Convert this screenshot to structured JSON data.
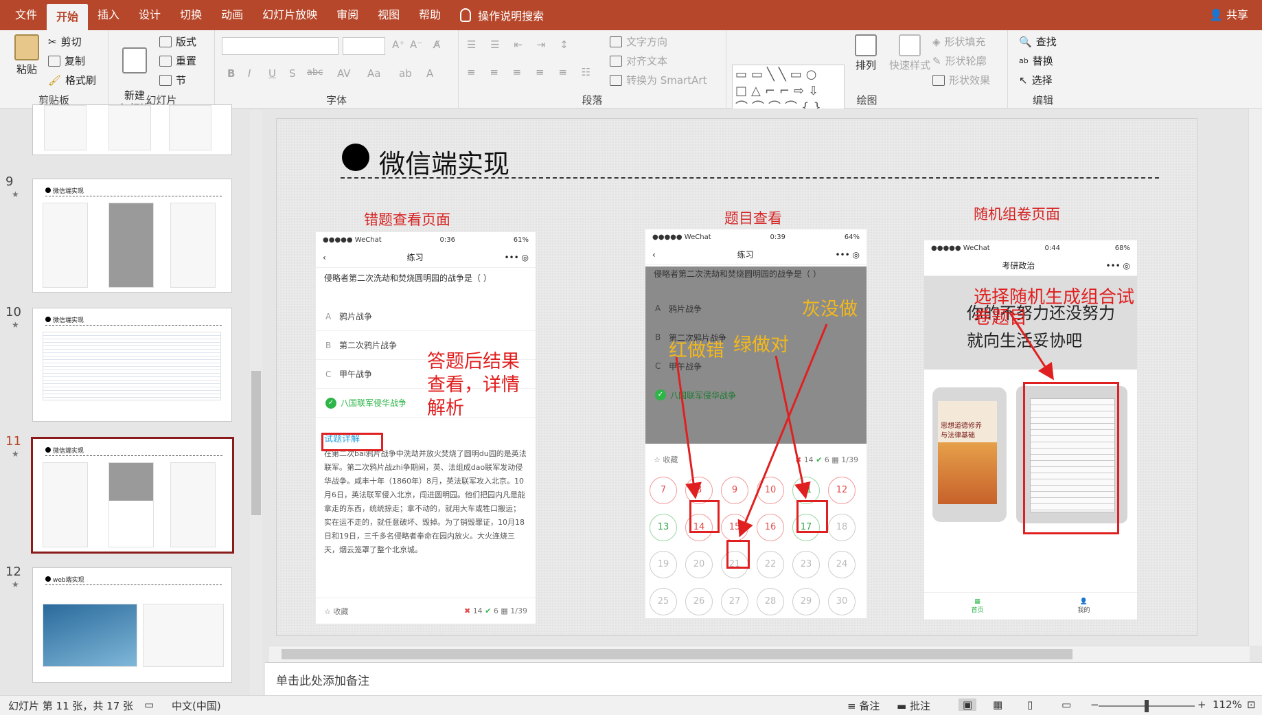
{
  "tabs": [
    "文件",
    "开始",
    "插入",
    "设计",
    "切换",
    "动画",
    "幻灯片放映",
    "审阅",
    "视图",
    "帮助"
  ],
  "tellme": "操作说明搜索",
  "share": "共享",
  "ribbon": {
    "clipboard": {
      "paste": "粘贴",
      "cut": "剪切",
      "copy": "复制",
      "format_painter": "格式刷",
      "label": "剪贴板"
    },
    "slides": {
      "new_slide": "新建\n幻灯片",
      "layout": "版式",
      "reset": "重置",
      "section": "节",
      "label": "幻灯片"
    },
    "font": {
      "label": "字体",
      "bold": "B",
      "italic": "I",
      "underline": "U",
      "shadow": "S",
      "strike": "abc",
      "spacing": "AV",
      "case": "Aa",
      "color": "A"
    },
    "paragraph": {
      "label": "段落",
      "text_direction": "文字方向",
      "align_text": "对齐文本",
      "smartart": "转换为 SmartArt"
    },
    "drawing": {
      "label": "绘图",
      "arrange": "排列",
      "quick_styles": "快速样式",
      "fill": "形状填充",
      "outline": "形状轮廓",
      "effects": "形状效果"
    },
    "editing": {
      "label": "编辑",
      "find": "查找",
      "replace": "替换",
      "select": "选择"
    }
  },
  "thumbnails": [
    {
      "num": "",
      "title": ""
    },
    {
      "num": "9",
      "title": "微信端实现"
    },
    {
      "num": "10",
      "title": "微信端实现"
    },
    {
      "num": "11",
      "title": "微信端实现"
    },
    {
      "num": "12",
      "title": "web端实现"
    }
  ],
  "slide": {
    "title": "微信端实现",
    "captions": [
      "错题查看页面",
      "题目查看",
      "随机组卷页面"
    ],
    "phone1": {
      "carrier": "●●●●● WeChat",
      "time": "0:36",
      "battery": "61%",
      "nav": "练习",
      "question": "侵略者第二次洗劫和焚烧圆明园的战争是（ ）",
      "options": [
        [
          "A",
          "鸦片战争"
        ],
        [
          "B",
          "第二次鸦片战争"
        ],
        [
          "C",
          "甲午战争"
        ],
        [
          "",
          "八国联军侵华战争"
        ]
      ],
      "detail_title": "试题详解",
      "detail": "在第二次bai鸦片战争中洗劫并放火焚烧了圆明du园的是英法联军。第二次鸦片战zhi争期间，英、法组成dao联军发动侵华战争。咸丰十年（1860年）8月，英法联军攻入北京。10月6日，英法联军侵入北京，闯进圆明园。他们把园内凡是能拿走的东西，统统掠走；拿不动的，就用大车或牲口搬运；实在运不走的，就任意破坏、毁掉。为了销毁罪证，10月18日和19日，三千多名侵略者奉命在园内放火。大火连烧三天，烟云笼罩了整个北京城。",
      "footer": {
        "fav": "收藏",
        "wrong": "14",
        "right": "6",
        "progress": "1/39"
      }
    },
    "phone2": {
      "carrier": "●●●●● WeChat",
      "time": "0:39",
      "battery": "64%",
      "nav": "练习",
      "question": "侵略者第二次洗劫和焚烧圆明园的战争是（ ）",
      "options": [
        [
          "A",
          "鸦片战争"
        ],
        [
          "B",
          "第二次鸦片战争"
        ],
        [
          "C",
          "甲午战争"
        ],
        [
          "",
          "八国联军侵华战争"
        ]
      ],
      "footer": {
        "fav": "收藏",
        "wrong": "14",
        "right": "6",
        "progress": "1/39"
      },
      "numbers": [
        "7",
        "8",
        "9",
        "10",
        "11",
        "12",
        "13",
        "14",
        "15",
        "16",
        "17",
        "18",
        "19",
        "20",
        "21",
        "22",
        "23",
        "24",
        "25",
        "26",
        "27",
        "28",
        "29",
        "30"
      ],
      "red": [
        "7",
        "8",
        "9",
        "10",
        "12",
        "14",
        "15",
        "16"
      ],
      "green": [
        "11",
        "13",
        "17"
      ]
    },
    "phone3": {
      "carrier": "●●●●● WeChat",
      "time": "0:44",
      "battery": "68%",
      "nav": "考研政治",
      "banner": "你的不努力还没努力\n就向生活妥协吧",
      "book_title": "思想道德修养\n与法律基础",
      "tab_home": "首页",
      "tab_me": "我的"
    },
    "annotations": {
      "result_view": "答题后结果\n查看，详情\n解析",
      "red_wrong": "红做错",
      "green_right": "绿做对",
      "gray_undone": "灰没做",
      "random_paper": "选择随机生成组合试\n卷题目"
    }
  },
  "notes_placeholder": "单击此处添加备注",
  "status": {
    "slide_info": "幻灯片 第 11 张，共 17 张",
    "language": "中文(中国)",
    "notes": "备注",
    "comments": "批注",
    "zoom": "112%"
  }
}
